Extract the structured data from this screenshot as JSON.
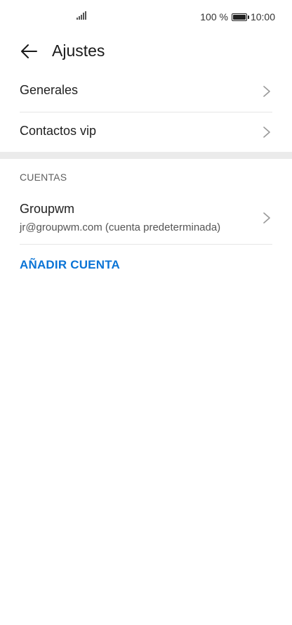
{
  "status_bar": {
    "battery_percent": "100 %",
    "time": "10:00",
    "signal_icon": "signal-icon",
    "battery_icon": "battery-icon"
  },
  "header": {
    "back_icon": "arrow-left-icon",
    "title": "Ajustes"
  },
  "settings_items": [
    {
      "label": "Generales",
      "icon": "chevron-right-icon"
    },
    {
      "label": "Contactos vip",
      "icon": "chevron-right-icon"
    }
  ],
  "accounts_section": {
    "header": "CUENTAS",
    "accounts": [
      {
        "name": "Groupwm",
        "email": "jr@groupwm.com (cuenta predeterminada)",
        "icon": "chevron-right-icon"
      }
    ],
    "add_account_label": "AÑADIR CUENTA"
  },
  "colors": {
    "accent": "#0a74d6",
    "text": "#1f1f1f",
    "secondary_text": "#5f5f5f",
    "divider": "#e6e6e6",
    "section_gap": "#ebebeb"
  }
}
